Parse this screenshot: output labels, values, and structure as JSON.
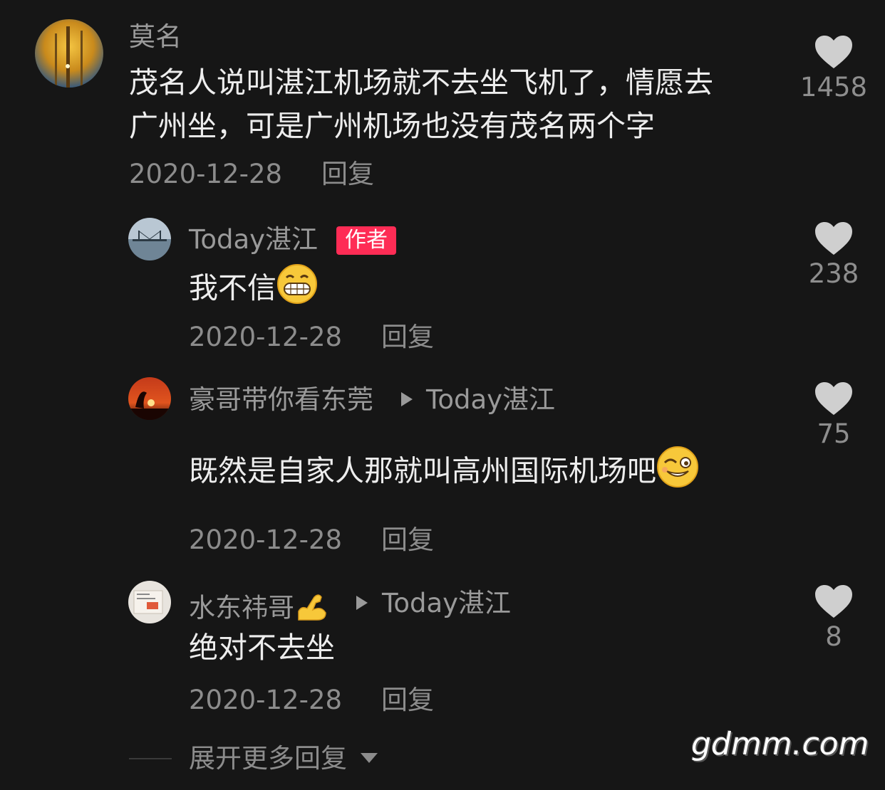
{
  "comments": [
    {
      "username": "莫名",
      "text_lines": [
        "茂名人说叫湛江机场就不去坐飞机了，情愿去",
        "广州坐，可是广州机场也没有茂名两个字"
      ],
      "date": "2020-12-28",
      "reply_label": "回复",
      "likes": "1458"
    },
    {
      "username": "Today湛江",
      "badge": "作者",
      "text": "我不信",
      "date": "2020-12-28",
      "reply_label": "回复",
      "likes": "238"
    },
    {
      "username": "豪哥带你看东莞",
      "reply_to": "Today湛江",
      "text": "既然是自家人那就叫高州国际机场吧",
      "date": "2020-12-28",
      "reply_label": "回复",
      "likes": "75"
    },
    {
      "username": "水东祎哥",
      "reply_to": "Today湛江",
      "text": "绝对不去坐",
      "date": "2020-12-28",
      "reply_label": "回复",
      "likes": "8"
    }
  ],
  "expand_label": "展开更多回复",
  "watermark": "gdmm.com",
  "icons": {
    "like": "heart-icon",
    "reply_arrow": "play-arrow-icon",
    "expand": "caret-down-icon"
  },
  "colors": {
    "background": "#161616",
    "badge": "#fe2c55",
    "heart": "#cfcfcf"
  }
}
